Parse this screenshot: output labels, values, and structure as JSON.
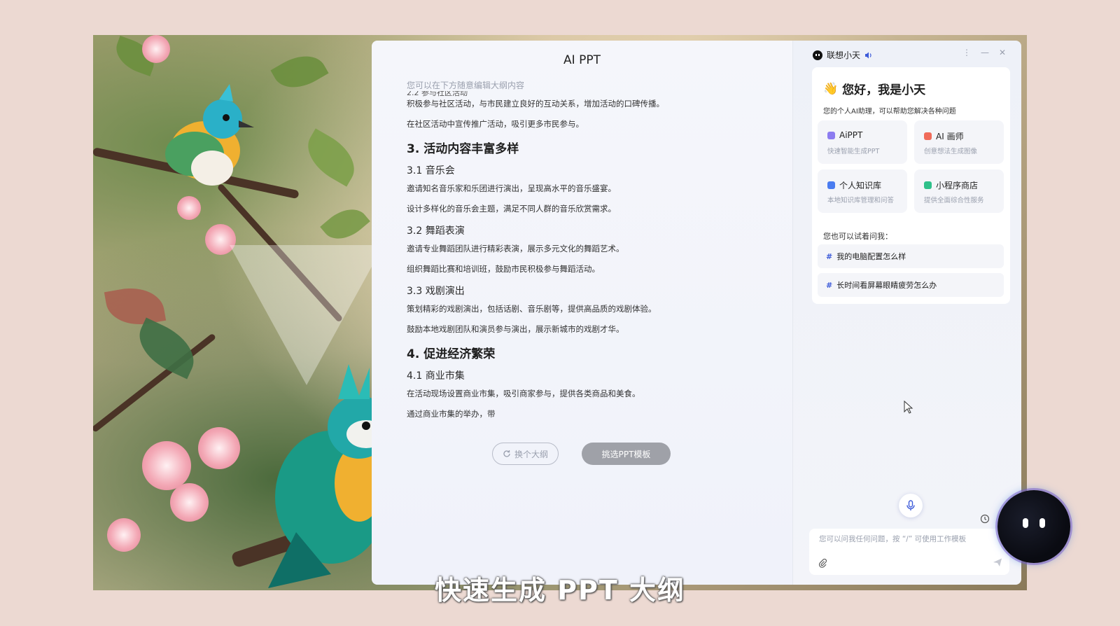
{
  "ppt": {
    "title": "AI PPT",
    "hint": "您可以在下方随意编辑大纲内容",
    "outline": {
      "cut_line": "2.2 参与社区活动",
      "lines": [
        {
          "type": "p",
          "text": "积极参与社区活动，与市民建立良好的互动关系，增加活动的口碑传播。"
        },
        {
          "type": "p",
          "text": "在社区活动中宣传推广活动，吸引更多市民参与。"
        },
        {
          "type": "h1",
          "text": "3. 活动内容丰富多样"
        },
        {
          "type": "h2",
          "text": "3.1 音乐会"
        },
        {
          "type": "p",
          "text": "邀请知名音乐家和乐团进行演出，呈现高水平的音乐盛宴。"
        },
        {
          "type": "p",
          "text": "设计多样化的音乐会主题，满足不同人群的音乐欣赏需求。"
        },
        {
          "type": "h2",
          "text": "3.2 舞蹈表演"
        },
        {
          "type": "p",
          "text": "邀请专业舞蹈团队进行精彩表演，展示多元文化的舞蹈艺术。"
        },
        {
          "type": "p",
          "text": "组织舞蹈比赛和培训班，鼓励市民积极参与舞蹈活动。"
        },
        {
          "type": "h2",
          "text": "3.3 戏剧演出"
        },
        {
          "type": "p",
          "text": "策划精彩的戏剧演出，包括话剧、音乐剧等，提供高品质的戏剧体验。"
        },
        {
          "type": "p",
          "text": "鼓励本地戏剧团队和演员参与演出，展示新城市的戏剧才华。"
        },
        {
          "type": "h1",
          "text": "4. 促进经济繁荣"
        },
        {
          "type": "h2",
          "text": "4.1 商业市集"
        },
        {
          "type": "p",
          "text": "在活动现场设置商业市集，吸引商家参与，提供各类商品和美食。"
        },
        {
          "type": "p",
          "text": "通过商业市集的举办，带"
        }
      ]
    },
    "buttons": {
      "reoutline": "换个大纲",
      "template": "挑选PPT模板"
    }
  },
  "assistant": {
    "name": "联想小天",
    "window_controls": [
      "⋮",
      "—",
      "✕"
    ],
    "greeting": "您好，我是小天",
    "greeting_emoji": "👋",
    "subtitle": "您的个人AI助理，可以帮助您解决各种问题",
    "features": [
      {
        "title": "AiPPT",
        "desc": "快速智能生成PPT",
        "color": "#8c7cf0"
      },
      {
        "title": "AI 画师",
        "desc": "创意想法生成图像",
        "color": "#f06b5a"
      },
      {
        "title": "个人知识库",
        "desc": "本地知识库管理和问答",
        "color": "#4a7cf0"
      },
      {
        "title": "小程序商店",
        "desc": "提供全面综合性服务",
        "color": "#2fc08a"
      }
    ],
    "ask_title": "您也可以试着问我：",
    "suggestions": [
      {
        "hash": "#",
        "text": "我的电脑配置怎么样"
      },
      {
        "hash": "#",
        "text": "长时间看屏幕眼睛疲劳怎么办"
      }
    ],
    "input_placeholder": "您可以问我任何问题，按 “/” 可使用工作模板"
  },
  "caption": "快速生成 PPT 大纲"
}
